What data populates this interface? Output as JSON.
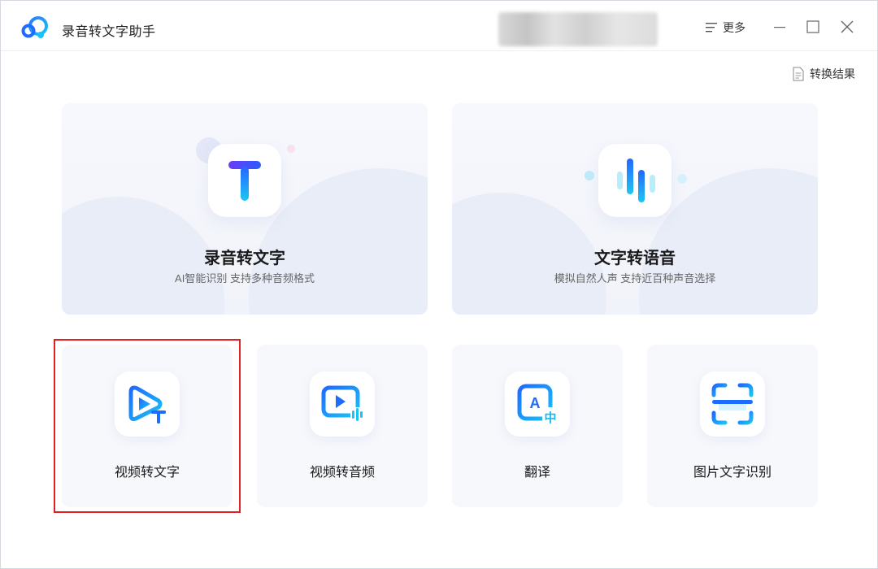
{
  "app": {
    "title": "录音转文字助手",
    "more_label": "更多"
  },
  "toolbar": {
    "result_label": "转换结果"
  },
  "big_cards": [
    {
      "title": "录音转文字",
      "subtitle": "AI智能识别 支持多种音频格式",
      "icon": "text-t-icon"
    },
    {
      "title": "文字转语音",
      "subtitle": "模拟自然人声 支持近百种声音选择",
      "icon": "audio-wave-icon"
    }
  ],
  "small_cards": [
    {
      "title": "视频转文字",
      "icon": "video-to-text-icon"
    },
    {
      "title": "视频转音频",
      "icon": "video-to-audio-icon"
    },
    {
      "title": "翻译",
      "icon": "translate-icon"
    },
    {
      "title": "图片文字识别",
      "icon": "scan-ocr-icon"
    }
  ],
  "colors": {
    "accent_blue": "#1e6bff",
    "accent_cyan": "#18c8f0",
    "highlight_red": "#e02020"
  }
}
